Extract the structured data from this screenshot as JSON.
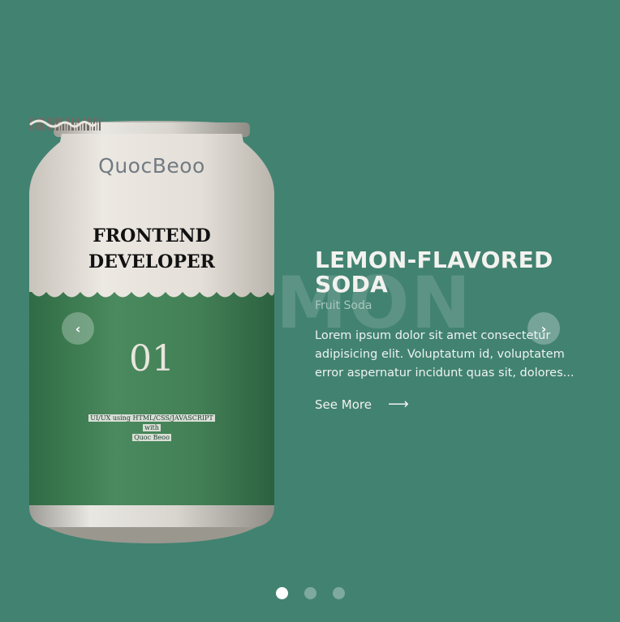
{
  "slide": {
    "background_word": "MON",
    "title": "LEMON-FLAVORED SODA",
    "subtitle": "Fruit Soda",
    "description": "Lorem ipsum dolor sit amet consectetur adipisicing elit. Voluptatum id, voluptatem error aspernatur incidunt quas sit, dolores...",
    "see_more_label": "See More",
    "see_more_icon": "arrow-right-icon"
  },
  "can": {
    "brand": "QuocBeoo",
    "title_line1": "FRONTEND",
    "title_line2": "DEVELOPER",
    "number": "01",
    "credits_line1": "UI/UX using HTML/CSS/JAVASCRIPT",
    "credits_line2": "with",
    "credits_line3": "Quoc Beoo",
    "colors": {
      "top": "#e6e1da",
      "bottom": "#3f8055",
      "metal": "#c9c6c0"
    }
  },
  "navigation": {
    "prev_icon": "chevron-left-icon",
    "prev_glyph": "‹",
    "next_icon": "chevron-right-icon",
    "next_glyph": "›"
  },
  "pagination": {
    "count": 3,
    "active_index": 0
  },
  "colors": {
    "background": "#428271",
    "accent": "#ffffff"
  }
}
